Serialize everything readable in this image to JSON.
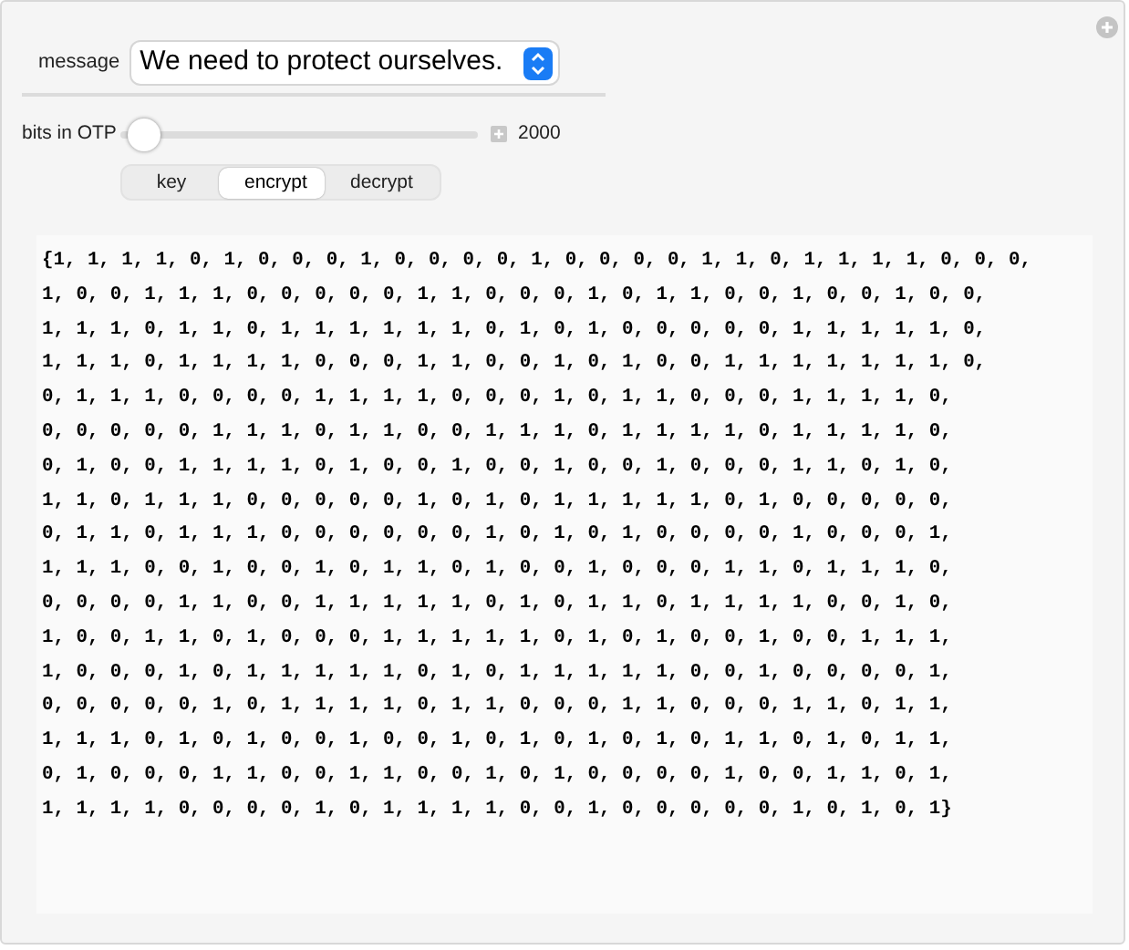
{
  "message": {
    "label": "message",
    "value": "We need to protect ourselves."
  },
  "slider": {
    "label": "bits in OTP",
    "level": 0.02,
    "reading": "2000"
  },
  "tabs": [
    {
      "label": "key",
      "selected": false
    },
    {
      "label": "encrypt",
      "selected": true
    },
    {
      "label": "decrypt",
      "selected": false
    }
  ],
  "output_lines": [
    "{1, 1, 1, 1, 0, 1, 0, 0, 0, 1, 0, 0, 0, 0, 1, 0, 0, 0, 0, 1, 1, 0, 1, 1, 1, 1, 0, 0, 0,",
    "1, 0, 0, 1, 1, 1, 0, 0, 0, 0, 0, 1, 1, 0, 0, 0, 1, 0, 1, 1, 0, 0, 1, 0, 0, 1, 0, 0,",
    "1, 1, 1, 0, 1, 1, 0, 1, 1, 1, 1, 1, 1, 0, 1, 0, 1, 0, 0, 0, 0, 0, 1, 1, 1, 1, 1, 0,",
    "1, 1, 1, 0, 1, 1, 1, 1, 0, 0, 0, 1, 1, 0, 0, 1, 0, 1, 0, 0, 1, 1, 1, 1, 1, 1, 1, 0,",
    "0, 1, 1, 1, 0, 0, 0, 0, 1, 1, 1, 1, 0, 0, 0, 1, 0, 1, 1, 0, 0, 0, 1, 1, 1, 1, 0,",
    "0, 0, 0, 0, 0, 1, 1, 1, 0, 1, 1, 0, 0, 1, 1, 1, 0, 1, 1, 1, 1, 0, 1, 1, 1, 1, 0,",
    "0, 1, 0, 0, 1, 1, 1, 1, 0, 1, 0, 0, 1, 0, 0, 1, 0, 0, 1, 0, 0, 0, 1, 1, 0, 1, 0,",
    "1, 1, 0, 1, 1, 1, 0, 0, 0, 0, 0, 1, 0, 1, 0, 1, 1, 1, 1, 1, 0, 1, 0, 0, 0, 0, 0,",
    "0, 1, 1, 0, 1, 1, 1, 0, 0, 0, 0, 0, 0, 1, 0, 1, 0, 1, 0, 0, 0, 0, 1, 0, 0, 0, 1,",
    "1, 1, 1, 0, 0, 1, 0, 0, 1, 0, 1, 1, 0, 1, 0, 0, 1, 0, 0, 0, 1, 1, 0, 1, 1, 1, 0,",
    "0, 0, 0, 0, 1, 1, 0, 0, 1, 1, 1, 1, 1, 0, 1, 0, 1, 1, 0, 1, 1, 1, 1, 0, 0, 1, 0,",
    "1, 0, 0, 1, 1, 0, 1, 0, 0, 0, 1, 1, 1, 1, 1, 0, 1, 0, 1, 0, 0, 1, 0, 0, 1, 1, 1,",
    "1, 0, 0, 0, 1, 0, 1, 1, 1, 1, 1, 0, 1, 0, 1, 1, 1, 1, 1, 0, 0, 1, 0, 0, 0, 0, 1,",
    "0, 0, 0, 0, 0, 1, 0, 1, 1, 1, 1, 0, 1, 1, 0, 0, 0, 1, 1, 0, 0, 0, 1, 1, 0, 1, 1,",
    "1, 1, 1, 0, 1, 0, 1, 0, 0, 1, 0, 0, 1, 0, 1, 0, 1, 0, 1, 0, 1, 1, 0, 1, 0, 1, 1,",
    "0, 1, 0, 0, 0, 1, 1, 0, 0, 1, 1, 0, 0, 1, 0, 1, 0, 0, 0, 0, 1, 0, 0, 1, 1, 0, 1,",
    "1, 1, 1, 1, 0, 0, 0, 0, 1, 0, 1, 1, 1, 1, 0, 0, 1, 0, 0, 0, 0, 0, 1, 0, 1, 0, 1}"
  ]
}
